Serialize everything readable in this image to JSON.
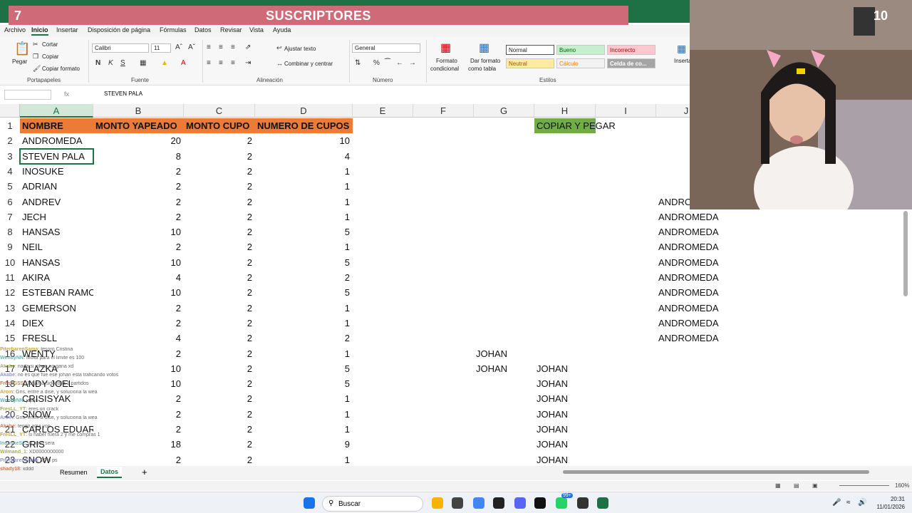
{
  "banner": {
    "left_number": "7",
    "title": "SUSCRIPTORES",
    "right_number": "10"
  },
  "ribbon_tabs": [
    "Archivo",
    "Inicio",
    "Insertar",
    "Disposición de página",
    "Fórmulas",
    "Datos",
    "Revisar",
    "Vista",
    "Ayuda"
  ],
  "ribbon": {
    "paste": "Pegar",
    "cut": "Cortar",
    "copy": "Copiar",
    "format_painter": "Copiar formato",
    "group_clipboard": "Portapapeles",
    "font_name": "Calibri",
    "font_size": "11",
    "group_font": "Fuente",
    "wrap_text": "Ajustar texto",
    "merge_center": "Combinar y centrar",
    "group_alignment": "Alineación",
    "number_format": "General",
    "group_number": "Número",
    "cond_format": "Formato",
    "cond_format2": "condicional",
    "table_format": "Dar formato",
    "table_format2": "como tabla",
    "styles": {
      "normal": "Normal",
      "bueno": "Bueno",
      "incorrecto": "Incorrecto",
      "neutral": "Neutral",
      "calculo": "Cálculo",
      "celda": "Celda de co..."
    },
    "group_styles": "Estilos",
    "insert": "Inserta"
  },
  "formula_bar": {
    "fx": "fx",
    "value": "STEVEN PALA"
  },
  "columns": [
    "A",
    "B",
    "C",
    "D",
    "E",
    "F",
    "G",
    "H",
    "I",
    "J"
  ],
  "rows": [
    "1",
    "2",
    "3",
    "4",
    "5",
    "6",
    "7",
    "8",
    "9",
    "10",
    "11",
    "12",
    "13",
    "14",
    "15",
    "16",
    "17",
    "18",
    "19",
    "20",
    "21",
    "22",
    "23"
  ],
  "headers": {
    "a": "NOMBRE",
    "b": "MONTO YAPEADO",
    "c": "MONTO CUPO",
    "d": "NUMERO DE CUPOS",
    "h": "COPIAR Y PEGAR"
  },
  "data_rows": [
    [
      "ANDROMEDA",
      "20",
      "2",
      "10"
    ],
    [
      "STEVEN PALA",
      "8",
      "2",
      "4"
    ],
    [
      "INOSUKE",
      "2",
      "2",
      "1"
    ],
    [
      "ADRIAN",
      "2",
      "2",
      "1"
    ],
    [
      "ANDREV",
      "2",
      "2",
      "1"
    ],
    [
      "JECH",
      "2",
      "2",
      "1"
    ],
    [
      "HANSAS",
      "10",
      "2",
      "5"
    ],
    [
      "NEIL",
      "2",
      "2",
      "1"
    ],
    [
      "HANSAS",
      "10",
      "2",
      "5"
    ],
    [
      "AKIRA",
      "4",
      "2",
      "2"
    ],
    [
      "ESTEBAN RAMO",
      "10",
      "2",
      "5"
    ],
    [
      "GEMERSON",
      "2",
      "2",
      "1"
    ],
    [
      "DIEX",
      "2",
      "2",
      "1"
    ],
    [
      "FRESLL",
      "4",
      "2",
      "2"
    ],
    [
      "WENTY",
      "2",
      "2",
      "1"
    ],
    [
      "ALAZKA",
      "10",
      "2",
      "5"
    ],
    [
      "ANDY JOEL",
      "10",
      "2",
      "5"
    ],
    [
      "CRISISYAK",
      "2",
      "2",
      "1"
    ],
    [
      "SNOW",
      "2",
      "2",
      "1"
    ],
    [
      "CARLOS EDUARD",
      "2",
      "2",
      "1"
    ],
    [
      "GRIS",
      "18",
      "2",
      "9"
    ],
    [
      "SNOW",
      "2",
      "2",
      "1"
    ]
  ],
  "col_g": [
    "JOHAN",
    "JOHAN"
  ],
  "col_h": [
    "JOHAN",
    "JOHAN",
    "JOHAN",
    "JOHAN",
    "JOHAN",
    "JOHAN",
    "JOHAN"
  ],
  "col_j": [
    "ANDROMEDA",
    "ANDROMEDA",
    "ANDROMEDA",
    "ANDROMEDA",
    "ANDROMEDA",
    "ANDROMEDA",
    "ANDROMEDA",
    "ANDROMEDA",
    "ANDROMEDA",
    "ANDROMEDA"
  ],
  "sheet_tabs": [
    "Resumen",
    "Datos"
  ],
  "add_sheet": "+",
  "zoom": "160%",
  "taskbar": {
    "search": "Buscar",
    "time": "20:31",
    "date": "11/01/2026",
    "badge": "99+"
  },
  "chat": [
    {
      "user": "PiterbarenSama",
      "msg": ": tesoro Cristina"
    },
    {
      "user": "WendyNN",
      "msg": ": Molia para el limite es 100"
    },
    {
      "user": "Akabe",
      "msg": ": nada si johan no gana xd"
    },
    {
      "user": "Akabe",
      "msg": ": no es que fue ese johan esta traficando votos"
    },
    {
      "user": "FresllGSS",
      "msg": ": Johan a sido falla 1 partidos"
    },
    {
      "user": "Aroin",
      "msg": ": Gris, entre a dise, y soluciona la wea"
    },
    {
      "user": "WendyNN",
      "msg": ": jajaja"
    },
    {
      "user": "FresLL_YT",
      "msg": ": eres un crack"
    },
    {
      "user": "Aroin",
      "msg": ": Gris, entre a dise, y soluciona la wea"
    },
    {
      "user": "Akabe",
      "msg": ": tengo aqui yoo"
    },
    {
      "user": "FresLL_YT",
      "msg": ": si haber fuera 2 y me compras 1"
    },
    {
      "user": "InosukeSC",
      "msg": ": al pato sera"
    },
    {
      "user": "Wilmand_1",
      "msg": ": XD0000000000"
    },
    {
      "user": "PiterbarenSama",
      "msg": ": 20% ps"
    },
    {
      "user": "shady18",
      "msg": ": xddd"
    }
  ]
}
